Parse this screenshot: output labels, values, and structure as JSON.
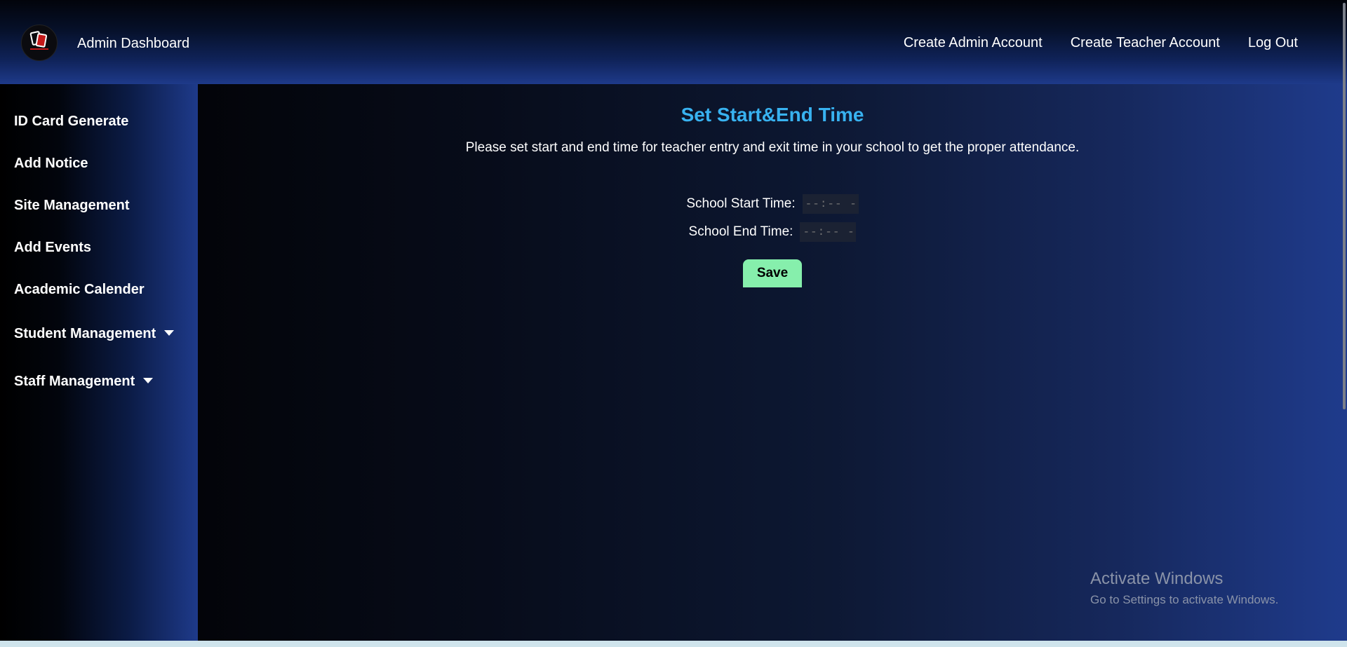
{
  "header": {
    "brand_title": "Admin Dashboard",
    "logo_icon": "id-card-logo-icon",
    "nav": [
      {
        "label": "Create Admin Account"
      },
      {
        "label": "Create Teacher Account"
      },
      {
        "label": "Log Out"
      }
    ]
  },
  "sidebar": {
    "items": [
      {
        "label": "ID Card Generate"
      },
      {
        "label": "Add Notice"
      },
      {
        "label": "Site Management"
      },
      {
        "label": "Add Events"
      },
      {
        "label": "Academic Calender"
      },
      {
        "label": "Student Management",
        "has_dropdown": true
      },
      {
        "label": "Staff Management",
        "has_dropdown": true
      }
    ]
  },
  "main": {
    "title": "Set Start&End Time",
    "description": "Please set start and end time for teacher entry and exit time in your school to get the proper attendance.",
    "start_time": {
      "label": "School Start Time:",
      "placeholder": "--:-- --"
    },
    "end_time": {
      "label": "School End Time:",
      "placeholder": "--:-- --"
    },
    "save_label": "Save"
  },
  "watermark": {
    "title": "Activate Windows",
    "subtitle": "Go to Settings to activate Windows."
  },
  "colors": {
    "title": "#38b2f0",
    "save_button": "#86efac",
    "header_accent": "#1e3a8a"
  }
}
